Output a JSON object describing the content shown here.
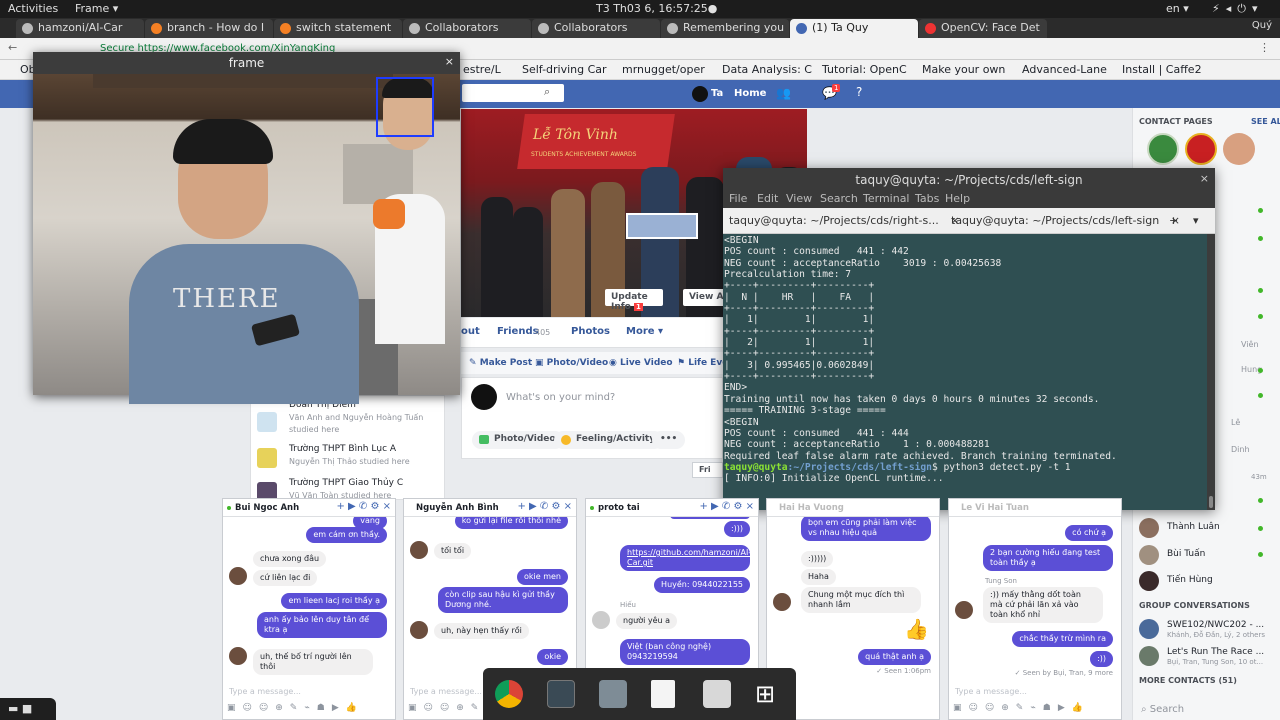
{
  "system": {
    "activities": "Activities",
    "app_menu": "Frame ▾",
    "clock": "T3 Th03  6, 16:57:25●",
    "lang": "en ▾",
    "user": "Quý"
  },
  "browser": {
    "tabs": [
      "hamzoni/AI-Car",
      "branch - How do I",
      "switch statement",
      "Collaborators",
      "Collaborators",
      "Remembering you",
      "(1) Ta Quy",
      "OpenCV: Face Det"
    ],
    "url": "Secure  https://www.facebook.com/XinYangKing",
    "bookmarks": [
      "Ob",
      "estre/L",
      "Self-driving Car",
      "mrnugget/oper",
      "Data Analysis: C",
      "Tutorial: OpenC",
      "Make your own",
      "Advanced-Lane",
      "Install | Caffe2"
    ]
  },
  "facebook": {
    "profile_name": "Ta",
    "home": "Home",
    "notif_count": "1",
    "update_info": "Update Info",
    "update_badge": "1",
    "view_activity": "View Acti",
    "nav": {
      "about": "out",
      "friends": "Friends",
      "friends_count": "405",
      "photos": "Photos",
      "more": "More ▾"
    },
    "actions": [
      "Make Post",
      "Photo/Video",
      "Live Video",
      "Life Even"
    ],
    "composer_placeholder": "What's on your mind?",
    "chips": [
      "Photo/Video",
      "Feeling/Activity",
      "•••"
    ],
    "fri_btn": "Fri",
    "cover_banner": "Lễ Tôn Vinh",
    "cover_sub": "STUDENTS ACHIEVEMENT AWARDS",
    "schools": [
      {
        "name": "Đoàn Thị Điểm",
        "sub": "Văn Anh and Nguyễn Hoàng Tuấn",
        "sub2": "studied here"
      },
      {
        "name": "Trường THPT Bình Lục A",
        "sub": "Nguyễn Thị Thảo studied here",
        "sub2": ""
      },
      {
        "name": "Trường THPT Giao Thủy C",
        "sub": "Vũ Văn Toàn studied here",
        "sub2": ""
      }
    ],
    "sidebar": {
      "contact_pages": "CONTACT PAGES",
      "see_all": "SEE ALL",
      "friends_visible": [
        {
          "name": "Thành Luân"
        },
        {
          "name": "Bùi Tuấn"
        },
        {
          "name": "Tiến Hùng"
        }
      ],
      "partial_names": [
        "Viên",
        "Hung",
        "Lê",
        "Dinh",
        "43m"
      ],
      "group_conv": "GROUP CONVERSATIONS",
      "groups": [
        {
          "name": "SWE102/NWC202 - ...",
          "sub": "Khánh, Đỗ Đần, Lý, 2 others"
        },
        {
          "name": "Let's Run The Race ...",
          "sub": "Bụi, Tran, Tung Son, 10 ot..."
        }
      ],
      "more_contacts": "MORE CONTACTS (51)",
      "search": "Search"
    }
  },
  "frame_window": {
    "title": "frame",
    "close": "×"
  },
  "terminal": {
    "title": "taquy@quyta: ~/Projects/cds/left-sign",
    "menu": [
      "File",
      "Edit",
      "View",
      "Search",
      "Terminal",
      "Tabs",
      "Help"
    ],
    "tabs": [
      "taquy@quyta: ~/Projects/cds/right-s...",
      "taquy@quyta: ~/Projects/cds/left-sign"
    ],
    "lines": [
      "<BEGIN",
      "POS count : consumed   441 : 442",
      "NEG count : acceptanceRatio    3019 : 0.00425638",
      "Precalculation time: 7",
      "+----+---------+---------+",
      "|  N |    HR   |    FA   |",
      "+----+---------+---------+",
      "|   1|        1|        1|",
      "+----+---------+---------+",
      "|   2|        1|        1|",
      "+----+---------+---------+",
      "|   3| 0.995465|0.0602849|",
      "+----+---------+---------+",
      "END>",
      "Training until now has taken 0 days 0 hours 0 minutes 32 seconds.",
      "",
      "===== TRAINING 3-stage =====",
      "<BEGIN",
      "POS count : consumed   441 : 444",
      "NEG count : acceptanceRatio    1 : 0.000488281",
      "Required leaf false alarm rate achieved. Branch training terminated."
    ],
    "prompt_user": "taquy@quyta",
    "prompt_path": ":~/Projects/cds/left-sign",
    "prompt_cmd": "$ python3 detect.py -t 1",
    "last_line": "[ INFO:0] Initialize OpenCL runtime..."
  },
  "chats": [
    {
      "name": "Bui Ngoc Anh",
      "msgs": [
        "vang",
        "em cám ơn thầy.",
        "chưa xong đâu",
        "cứ liên lạc đi",
        "em lieen lacj roi thầy ạ",
        "anh ấy bảo lên duy tân để ktra ạ",
        "uh, thế bố trí người lên thôi"
      ]
    },
    {
      "name": "Nguyễn Anh Bình",
      "msgs": [
        "ko gửi lại file rồi thôi nhé",
        "tối tối",
        "okie men",
        "còn clip sau hậu kì gửi thầy Dương nhé.",
        "uh, này hẹn thấy rồi",
        "okie"
      ]
    },
    {
      "name": "proto tai",
      "msgs": [
        "",
        ":)))",
        "https://github.com/hamzoni/AI-Car.git",
        "Huyền: 0944022155",
        "Hiếu",
        "người yêu a",
        "Việt (ban công nghệ) 0943219594"
      ]
    },
    {
      "name": "Hai Ha Vuong",
      "msgs": [
        "bọn em cũng phải làm việc vs nhau hiệu quả",
        ":)))))",
        "Haha",
        "Chung một mục đích thì nhanh lắm",
        "quá thật anh ạ",
        "✓ Seen 1:06pm"
      ]
    },
    {
      "name": "Le Vi Hai Tuan",
      "msgs": [
        "có chứ ạ",
        "2 bạn cường hiếu đang test toàn thầy ạ",
        "Tung Son",
        ":)) mấy thằng dốt toàn mà cứ phải lăn xả vào toàn khổ nhỉ",
        "chắc thầy trừ mình ra",
        ":))",
        "✓ Seen by Bụi, Tran, 9 more"
      ]
    }
  ],
  "chat_placeholder": "Type a message...",
  "colors": {
    "fb_blue": "#4267b2",
    "terminal_bg": "#2f4f52",
    "bubble": "#5b4fd6"
  }
}
